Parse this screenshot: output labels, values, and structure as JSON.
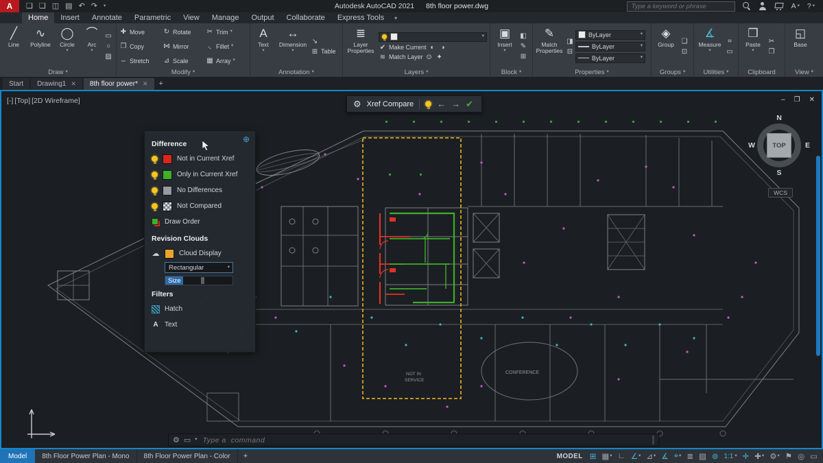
{
  "colors": {
    "accent_blue": "#1587cc",
    "diff_red": "#d8271b",
    "diff_green": "#3fae2a",
    "diff_gray": "#979b9f",
    "cloud_orange": "#d9a21f",
    "model_tab_blue": "#1f73b8"
  },
  "titlebar": {
    "logo": "A",
    "app_name": "Autodesk AutoCAD 2021",
    "doc_name": "8th floor power.dwg",
    "search_placeholder": "Type a keyword or phrase",
    "share_label": "A",
    "help_label": "?"
  },
  "glyphs": {
    "caret": "▾",
    "new_file": "❑",
    "open": "❏",
    "save": "◫",
    "plot": "▤",
    "undo": "↶",
    "redo": "↷",
    "line": "╱",
    "polyline": "∿",
    "circle": "◯",
    "arc": "⌒",
    "rect": "▭",
    "ellipse": "○",
    "hatch": "▨",
    "move": "✚",
    "rotate": "↻",
    "trim": "✂",
    "copy": "❐",
    "mirror": "⋈",
    "fillet": "◟",
    "stretch": "⇔",
    "scale": "⊿",
    "array": "▦",
    "text": "A",
    "dimension": "↔",
    "leader": "↘",
    "table": "⊞",
    "layer_props": "≣",
    "make_current": "✔",
    "match_layer": "≋",
    "layer_ic1": "◐",
    "layer_ic2": "◑",
    "layer_ic3": "⊙",
    "layer_ic4": "✦",
    "insert": "▣",
    "block_ic1": "◧",
    "block_ic2": "✎",
    "block_ic3": "⊞",
    "match_props": "✎",
    "props_ic1": "◨",
    "props_ic2": "⊟",
    "group": "◈",
    "group_ic1": "❏",
    "group_ic2": "⊡",
    "measure": "∡",
    "util_ic1": "⌗",
    "util_ic2": "▭",
    "paste": "❒",
    "clip_ic1": "✂",
    "clip_ic2": "❐",
    "base": "◱",
    "gear": "⚙",
    "arrow_left": "←",
    "arrow_right": "→",
    "check": "✔",
    "cloud": "☁",
    "minimize": "–",
    "restore": "❐",
    "close": "✕",
    "wrench": "⚙",
    "prompt": "▭",
    "globe": "⊕"
  },
  "ribbon_tabs": [
    "Home",
    "Insert",
    "Annotate",
    "Parametric",
    "View",
    "Manage",
    "Output",
    "Collaborate",
    "Express Tools"
  ],
  "ribbon": {
    "panels": {
      "draw": "Draw",
      "modify": "Modify",
      "annotation": "Annotation",
      "layers": "Layers",
      "block": "Block",
      "properties": "Properties",
      "groups": "Groups",
      "utilities": "Utilities",
      "clipboard": "Clipboard",
      "view": "View"
    },
    "labels": {
      "line": "Line",
      "polyline": "Polyline",
      "circle": "Circle",
      "arc": "Arc",
      "move": "Move",
      "rotate": "Rotate",
      "trim": "Trim",
      "copy": "Copy",
      "mirror": "Mirror",
      "fillet": "Fillet",
      "stretch": "Stretch",
      "scale": "Scale",
      "array": "Array",
      "text": "Text",
      "dimension": "Dimension",
      "table": "Table",
      "layer_properties": "Layer Properties",
      "make_current": "Make Current",
      "match_layer": "Match Layer",
      "insert": "Insert",
      "match_properties": "Match Properties",
      "bylayer": "ByLayer",
      "group": "Group",
      "measure": "Measure",
      "paste": "Paste",
      "base": "Base"
    }
  },
  "doc_tabs": {
    "start": "Start",
    "drawing1": "Drawing1",
    "current": "8th floor power*",
    "plus": "+"
  },
  "viewport_controls": {
    "minus": "[-]",
    "view": "[Top]",
    "visual": "[2D Wireframe]"
  },
  "xref": {
    "toolbar_title": "Xref Compare",
    "difference": "Difference",
    "not_in": "Not in Current Xref",
    "only_in": "Only in Current Xref",
    "no_diff": "No Differences",
    "not_compared": "Not Compared",
    "draw_order": "Draw Order",
    "revision_clouds": "Revision Clouds",
    "cloud_display": "Cloud Display",
    "shape_value": "Rectangular",
    "size_value": "Size",
    "filters": "Filters",
    "hatch": "Hatch",
    "text": "Text"
  },
  "compass": {
    "n": "N",
    "w": "W",
    "s": "S",
    "e": "E",
    "cube": "TOP",
    "wcs": "WCS"
  },
  "plan": {
    "conference": "CONFERENCE",
    "note1": "NOT IN",
    "note2": "SERVICE"
  },
  "command": {
    "placeholder": "Type a  command"
  },
  "statusbar": {
    "model": "Model",
    "layout1": "8th Floor Power Plan - Mono",
    "layout2": "8th Floor Power Plan - Color",
    "plus": "+",
    "space": "MODEL",
    "scale": "1:1",
    "icons": [
      {
        "name": "grid-icon",
        "glyph": "⊞"
      },
      {
        "name": "snap-icon",
        "glyph": "▦"
      },
      {
        "name": "ortho-icon",
        "glyph": "∟"
      },
      {
        "name": "polar-tracking-icon",
        "glyph": "∠"
      },
      {
        "name": "isodraft-icon",
        "glyph": "⊿"
      },
      {
        "name": "osnap-tracking-icon",
        "glyph": "∡"
      },
      {
        "name": "osnap-icon",
        "glyph": "⌖"
      },
      {
        "name": "lineweight-icon",
        "glyph": "≣"
      },
      {
        "name": "transparency-icon",
        "glyph": "▨"
      },
      {
        "name": "selection-cycling-icon",
        "glyph": "⊚"
      },
      {
        "name": "annotation-visibility-icon",
        "glyph": "✛"
      },
      {
        "name": "autoscale-icon",
        "glyph": "✚"
      },
      {
        "name": "workspace-icon",
        "glyph": "⚙"
      },
      {
        "name": "annotation-monitor-icon",
        "glyph": "⚑"
      },
      {
        "name": "isolate-objects-icon",
        "glyph": "◎"
      },
      {
        "name": "clean-screen-icon",
        "glyph": "▭"
      }
    ]
  }
}
